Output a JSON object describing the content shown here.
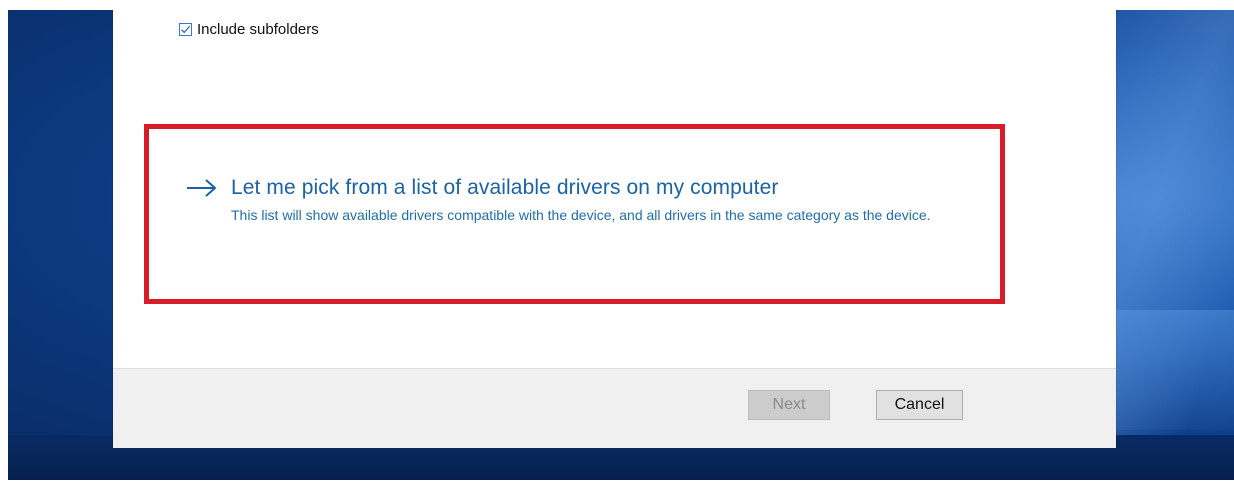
{
  "dialog": {
    "include_subfolders": {
      "label": "Include subfolders",
      "checked": true
    },
    "pick_option": {
      "title": "Let me pick from a list of available drivers on my computer",
      "description": "This list will show available drivers compatible with the device, and all drivers in the same category as the device.",
      "icon": "arrow-right-icon"
    },
    "buttons": {
      "next": "Next",
      "cancel": "Cancel"
    }
  },
  "colors": {
    "link": "#1a63a5",
    "highlight_border": "#d81d2a",
    "checkbox_accent": "#3b76c9",
    "desktop_blue": "#1b57ac"
  }
}
